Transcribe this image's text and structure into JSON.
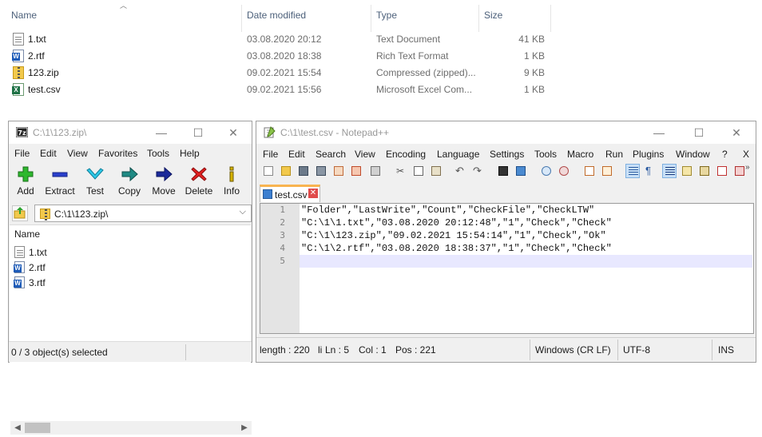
{
  "explorer": {
    "columns": {
      "name": "Name",
      "date": "Date modified",
      "type": "Type",
      "size": "Size"
    },
    "files": [
      {
        "name": "1.txt",
        "date": "03.08.2020 20:12",
        "type": "Text Document",
        "size": "41 KB",
        "icon": "text-file-icon"
      },
      {
        "name": "2.rtf",
        "date": "03.08.2020 18:38",
        "type": "Rich Text Format",
        "size": "1 KB",
        "icon": "word-document-icon"
      },
      {
        "name": "123.zip",
        "date": "09.02.2021 15:54",
        "type": "Compressed (zipped)...",
        "size": "9 KB",
        "icon": "zip-folder-icon"
      },
      {
        "name": "test.csv",
        "date": "09.02.2021 15:56",
        "type": "Microsoft Excel Com...",
        "size": "1 KB",
        "icon": "excel-csv-icon"
      }
    ]
  },
  "sevenzip": {
    "title": "C:\\1\\123.zip\\",
    "menu": [
      "File",
      "Edit",
      "View",
      "Favorites",
      "Tools",
      "Help"
    ],
    "toolbar": [
      "Add",
      "Extract",
      "Test",
      "Copy",
      "Move",
      "Delete",
      "Info"
    ],
    "path": "C:\\1\\123.zip\\",
    "column": "Name",
    "items": [
      "1.txt",
      "2.rtf",
      "3.rtf"
    ],
    "status": "0 / 3 object(s) selected"
  },
  "notepad": {
    "title": "C:\\1\\test.csv - Notepad++",
    "menu": [
      "File",
      "Edit",
      "Search",
      "View",
      "Encoding",
      "Language",
      "Settings",
      "Tools",
      "Macro",
      "Run",
      "Plugins",
      "Window",
      "?",
      "X"
    ],
    "tab": "test.csv",
    "lines": [
      "\"Folder\",\"LastWrite\",\"Count\",\"CheckFile\",\"CheckLTW\"",
      "\"C:\\1\\1.txt\",\"03.08.2020 20:12:48\",\"1\",\"Check\",\"Check\"",
      "\"C:\\1\\123.zip\",\"09.02.2021 15:54:14\",\"1\",\"Check\",\"Ok\"",
      "\"C:\\1\\2.rtf\",\"03.08.2020 18:38:37\",\"1\",\"Check\",\"Check\"",
      ""
    ],
    "line_numbers": [
      "1",
      "2",
      "3",
      "4",
      "5"
    ],
    "status": {
      "length": "length : 220",
      "lines": "li",
      "ln": "Ln : 5",
      "col": "Col : 1",
      "pos": "Pos : 221",
      "eol": "Windows (CR LF)",
      "encoding": "UTF-8",
      "mode": "INS"
    }
  },
  "window_controls": {
    "minimize": "—",
    "maximize": "☐",
    "close": "✕"
  },
  "colors": {
    "accent_tab": "#f8b450",
    "current_line": "#e8e8ff",
    "gutter": "#e4e4e4"
  }
}
